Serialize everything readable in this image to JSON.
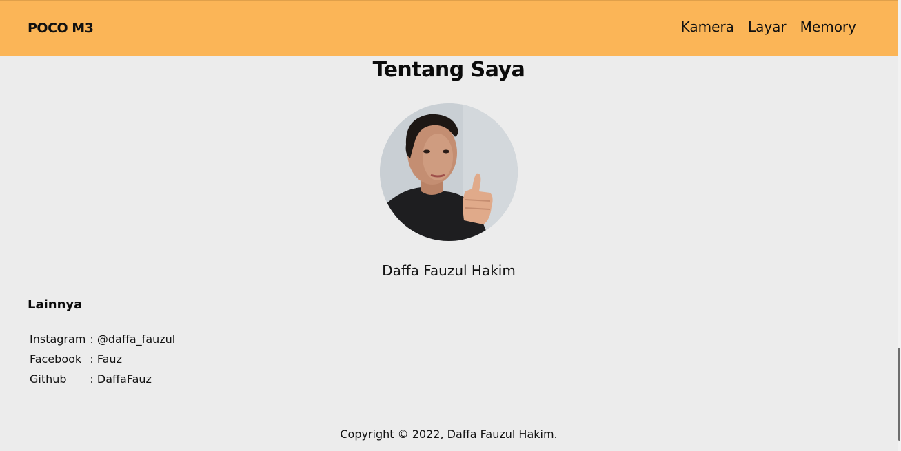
{
  "header": {
    "brand": "POCO M3",
    "nav": [
      {
        "label": "Kamera"
      },
      {
        "label": "Layar"
      },
      {
        "label": "Memory"
      }
    ],
    "background_color": "#fbb557"
  },
  "main": {
    "title": "Tentang Saya",
    "name": "Daffa Fauzul Hakim"
  },
  "other": {
    "heading": "Lainnya",
    "contacts": [
      {
        "label": "Instagram",
        "sep": ":",
        "value": "@daffa_fauzul"
      },
      {
        "label": "Facebook",
        "sep": ":",
        "value": "Fauz"
      },
      {
        "label": "Github",
        "sep": ":",
        "value": "DaffaFauz"
      }
    ]
  },
  "footer": {
    "text": "Copyright © 2022, Daffa Fauzul Hakim."
  },
  "page_background": "#ececec"
}
